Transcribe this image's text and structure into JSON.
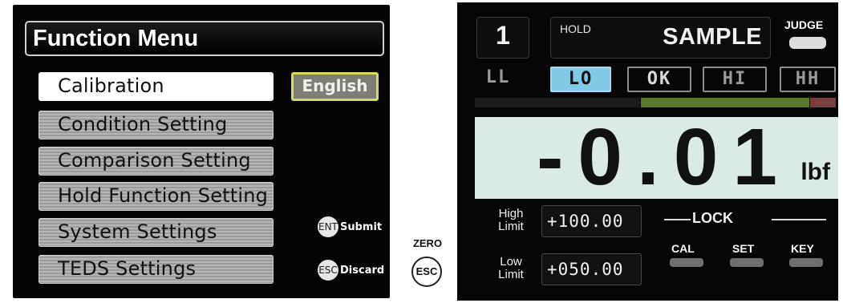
{
  "function_menu": {
    "title": "Function Menu",
    "items": [
      {
        "label": "Calibration",
        "selected": true
      },
      {
        "label": "Condition Setting",
        "selected": false
      },
      {
        "label": "Comparison Setting",
        "selected": false
      },
      {
        "label": "Hold Function Setting",
        "selected": false
      },
      {
        "label": "System Settings",
        "selected": false
      },
      {
        "label": "TEDS Settings",
        "selected": false
      }
    ],
    "language_button": "English",
    "key_hints": [
      {
        "key": "ENT",
        "label": "Submit"
      },
      {
        "key": "ESC",
        "label": "Discard"
      }
    ]
  },
  "physical_key": {
    "top_label": "ZERO",
    "key_label": "ESC"
  },
  "indicator": {
    "channel": "1",
    "hold_label": "HOLD",
    "hold_mode": "SAMPLE",
    "judge_label": "JUDGE",
    "judgments": [
      {
        "label": "LL",
        "active": false
      },
      {
        "label": "LO",
        "active": true
      },
      {
        "label": "OK",
        "active": false
      },
      {
        "label": "HI",
        "active": false
      },
      {
        "label": "HH",
        "active": false
      }
    ],
    "reading": "-0.01",
    "unit": "lbf",
    "high_limit_label_1": "High",
    "high_limit_label_2": "Limit",
    "high_limit_value": "+100.00",
    "low_limit_label_1": "Low",
    "low_limit_label_2": "Limit",
    "low_limit_value": "+050.00",
    "lock_title": "LOCK",
    "lock_items": [
      "CAL",
      "SET",
      "KEY"
    ],
    "colors": {
      "active_judge": "#82c9e6",
      "ok_band": "#5b7a2f",
      "hi_band": "#7a3f3f",
      "display_background": "#d9ebe4",
      "language_button_border": "#d6dc5a"
    }
  }
}
